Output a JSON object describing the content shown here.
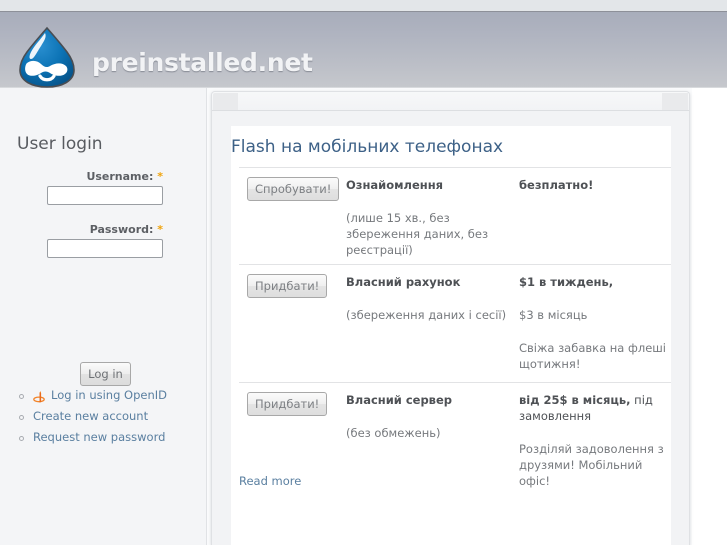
{
  "site": {
    "name": "preinstalled.net",
    "logo_icon": "drupal-droplet-icon",
    "logo_color": "#0a6aa8"
  },
  "sidebar": {
    "block_title": "User login",
    "username": {
      "label": "Username:",
      "required_marker": "*",
      "value": "",
      "placeholder": ""
    },
    "password": {
      "label": "Password:",
      "required_marker": "*",
      "value": "",
      "placeholder": ""
    },
    "login_button": "Log in",
    "links": [
      {
        "label": "Log in using OpenID",
        "icon": "openid-icon",
        "icon_color": "#f68a33"
      },
      {
        "label": "Create new account",
        "icon": "bullet-icon"
      },
      {
        "label": "Request new password",
        "icon": "bullet-icon"
      }
    ]
  },
  "main": {
    "node_title": "Flash на мобільних телефонах",
    "title_color": "#3d6187",
    "read_more": "Read more",
    "pricing_rows": [
      {
        "button": "Спробувати!",
        "name": "Ознайомлення",
        "description": "(лише 15 хв., без збереження даних, без реєстрації)",
        "price_main": "безплатно!",
        "price_sub": "",
        "note": ""
      },
      {
        "button": "Придбати!",
        "name": "Власний рахунок",
        "description": "(збереження даних і сесії)",
        "price_main": "$1 в тиждень,",
        "price_sub": "$3 в місяць",
        "note": "Свіжа забавка на флеші щотижня!"
      },
      {
        "button": "Придбати!",
        "name": "Власний сервер",
        "description": "(без обмежень)",
        "price_main": "від 25$ в місяць,",
        "price_main_tail": " під замовлення",
        "price_sub": "",
        "note": "Розділяй задоволення з друзями! Мобільний офіс!"
      }
    ]
  }
}
